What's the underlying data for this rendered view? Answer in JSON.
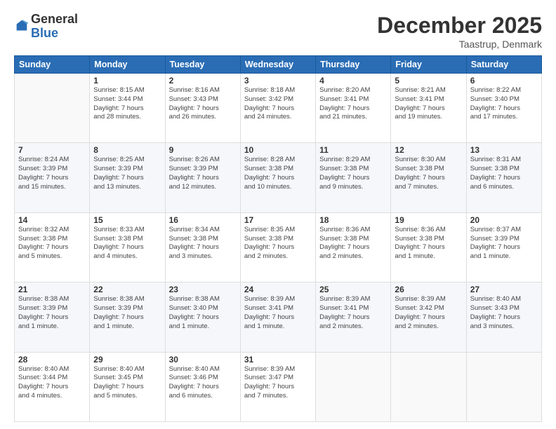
{
  "logo": {
    "general": "General",
    "blue": "Blue"
  },
  "title": "December 2025",
  "location": "Taastrup, Denmark",
  "headers": [
    "Sunday",
    "Monday",
    "Tuesday",
    "Wednesday",
    "Thursday",
    "Friday",
    "Saturday"
  ],
  "weeks": [
    [
      {
        "day": "",
        "info": ""
      },
      {
        "day": "1",
        "info": "Sunrise: 8:15 AM\nSunset: 3:44 PM\nDaylight: 7 hours\nand 28 minutes."
      },
      {
        "day": "2",
        "info": "Sunrise: 8:16 AM\nSunset: 3:43 PM\nDaylight: 7 hours\nand 26 minutes."
      },
      {
        "day": "3",
        "info": "Sunrise: 8:18 AM\nSunset: 3:42 PM\nDaylight: 7 hours\nand 24 minutes."
      },
      {
        "day": "4",
        "info": "Sunrise: 8:20 AM\nSunset: 3:41 PM\nDaylight: 7 hours\nand 21 minutes."
      },
      {
        "day": "5",
        "info": "Sunrise: 8:21 AM\nSunset: 3:41 PM\nDaylight: 7 hours\nand 19 minutes."
      },
      {
        "day": "6",
        "info": "Sunrise: 8:22 AM\nSunset: 3:40 PM\nDaylight: 7 hours\nand 17 minutes."
      }
    ],
    [
      {
        "day": "7",
        "info": "Sunrise: 8:24 AM\nSunset: 3:39 PM\nDaylight: 7 hours\nand 15 minutes."
      },
      {
        "day": "8",
        "info": "Sunrise: 8:25 AM\nSunset: 3:39 PM\nDaylight: 7 hours\nand 13 minutes."
      },
      {
        "day": "9",
        "info": "Sunrise: 8:26 AM\nSunset: 3:39 PM\nDaylight: 7 hours\nand 12 minutes."
      },
      {
        "day": "10",
        "info": "Sunrise: 8:28 AM\nSunset: 3:38 PM\nDaylight: 7 hours\nand 10 minutes."
      },
      {
        "day": "11",
        "info": "Sunrise: 8:29 AM\nSunset: 3:38 PM\nDaylight: 7 hours\nand 9 minutes."
      },
      {
        "day": "12",
        "info": "Sunrise: 8:30 AM\nSunset: 3:38 PM\nDaylight: 7 hours\nand 7 minutes."
      },
      {
        "day": "13",
        "info": "Sunrise: 8:31 AM\nSunset: 3:38 PM\nDaylight: 7 hours\nand 6 minutes."
      }
    ],
    [
      {
        "day": "14",
        "info": "Sunrise: 8:32 AM\nSunset: 3:38 PM\nDaylight: 7 hours\nand 5 minutes."
      },
      {
        "day": "15",
        "info": "Sunrise: 8:33 AM\nSunset: 3:38 PM\nDaylight: 7 hours\nand 4 minutes."
      },
      {
        "day": "16",
        "info": "Sunrise: 8:34 AM\nSunset: 3:38 PM\nDaylight: 7 hours\nand 3 minutes."
      },
      {
        "day": "17",
        "info": "Sunrise: 8:35 AM\nSunset: 3:38 PM\nDaylight: 7 hours\nand 2 minutes."
      },
      {
        "day": "18",
        "info": "Sunrise: 8:36 AM\nSunset: 3:38 PM\nDaylight: 7 hours\nand 2 minutes."
      },
      {
        "day": "19",
        "info": "Sunrise: 8:36 AM\nSunset: 3:38 PM\nDaylight: 7 hours\nand 1 minute."
      },
      {
        "day": "20",
        "info": "Sunrise: 8:37 AM\nSunset: 3:39 PM\nDaylight: 7 hours\nand 1 minute."
      }
    ],
    [
      {
        "day": "21",
        "info": "Sunrise: 8:38 AM\nSunset: 3:39 PM\nDaylight: 7 hours\nand 1 minute."
      },
      {
        "day": "22",
        "info": "Sunrise: 8:38 AM\nSunset: 3:39 PM\nDaylight: 7 hours\nand 1 minute."
      },
      {
        "day": "23",
        "info": "Sunrise: 8:38 AM\nSunset: 3:40 PM\nDaylight: 7 hours\nand 1 minute."
      },
      {
        "day": "24",
        "info": "Sunrise: 8:39 AM\nSunset: 3:41 PM\nDaylight: 7 hours\nand 1 minute."
      },
      {
        "day": "25",
        "info": "Sunrise: 8:39 AM\nSunset: 3:41 PM\nDaylight: 7 hours\nand 2 minutes."
      },
      {
        "day": "26",
        "info": "Sunrise: 8:39 AM\nSunset: 3:42 PM\nDaylight: 7 hours\nand 2 minutes."
      },
      {
        "day": "27",
        "info": "Sunrise: 8:40 AM\nSunset: 3:43 PM\nDaylight: 7 hours\nand 3 minutes."
      }
    ],
    [
      {
        "day": "28",
        "info": "Sunrise: 8:40 AM\nSunset: 3:44 PM\nDaylight: 7 hours\nand 4 minutes."
      },
      {
        "day": "29",
        "info": "Sunrise: 8:40 AM\nSunset: 3:45 PM\nDaylight: 7 hours\nand 5 minutes."
      },
      {
        "day": "30",
        "info": "Sunrise: 8:40 AM\nSunset: 3:46 PM\nDaylight: 7 hours\nand 6 minutes."
      },
      {
        "day": "31",
        "info": "Sunrise: 8:39 AM\nSunset: 3:47 PM\nDaylight: 7 hours\nand 7 minutes."
      },
      {
        "day": "",
        "info": ""
      },
      {
        "day": "",
        "info": ""
      },
      {
        "day": "",
        "info": ""
      }
    ]
  ]
}
